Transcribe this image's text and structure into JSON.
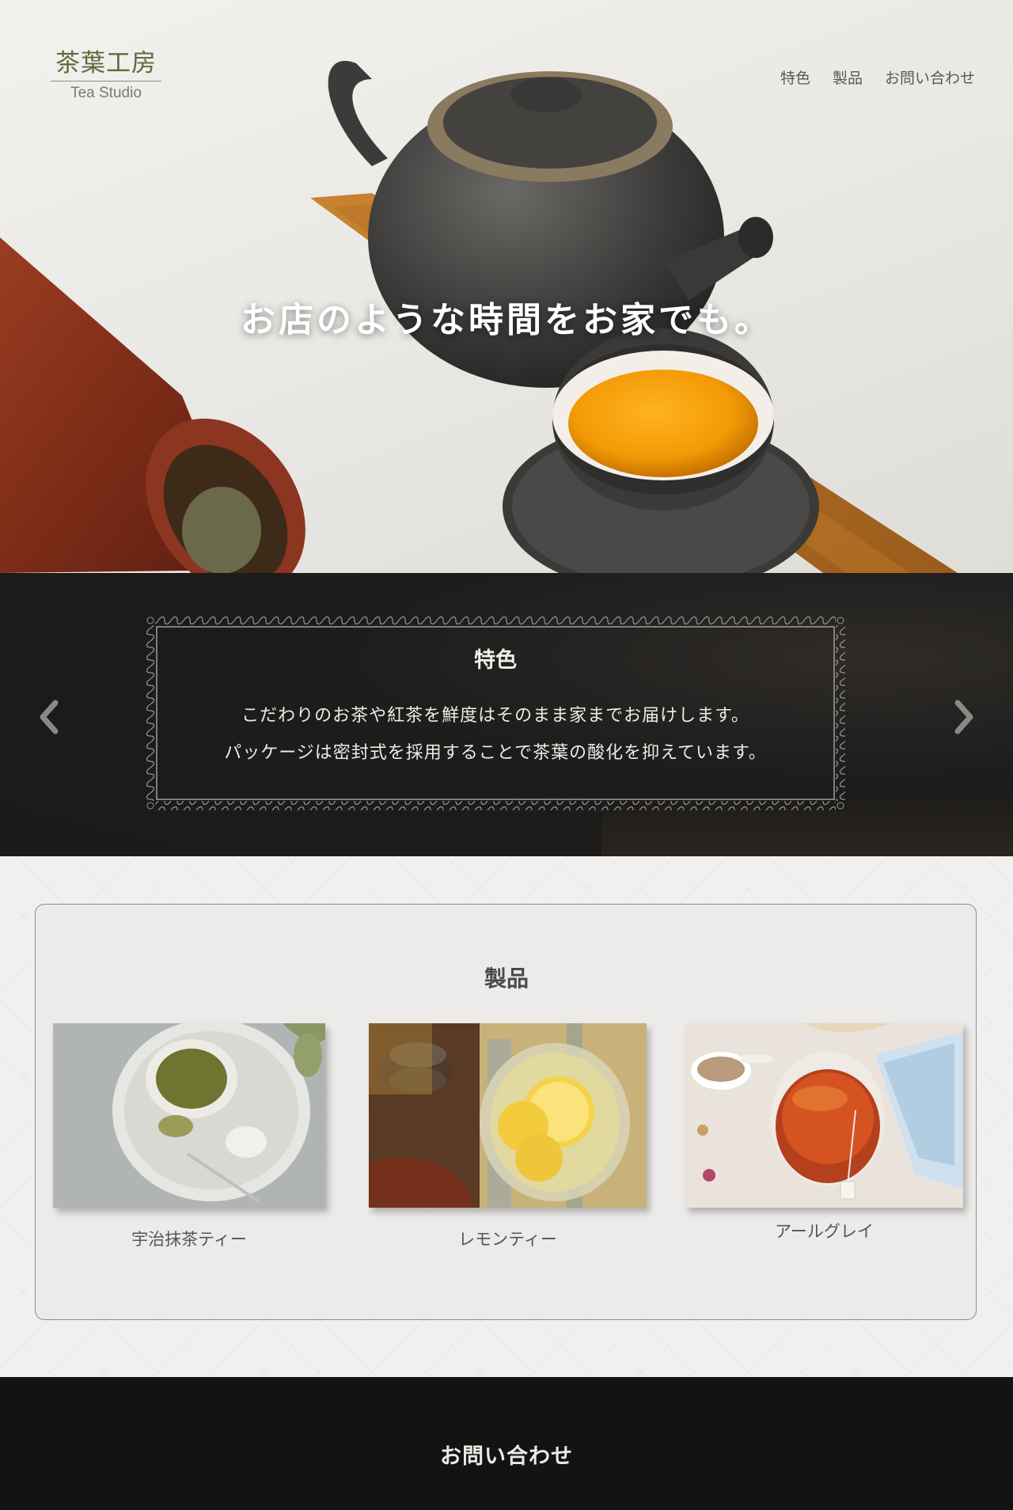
{
  "header": {
    "logo_jp": "茶葉工房",
    "logo_en": "Tea Studio",
    "nav": [
      {
        "label": "特色"
      },
      {
        "label": "製品"
      },
      {
        "label": "お問い合わせ"
      }
    ]
  },
  "hero": {
    "headline": "お店のような時間をお家でも。"
  },
  "feature": {
    "title": "特色",
    "line1": "こだわりのお茶や紅茶を鮮度はそのまま家までお届けします。",
    "line2": "パッケージは密封式を採用することで茶葉の酸化を抑えています。",
    "prev_icon": "chevron-left-icon",
    "next_icon": "chevron-right-icon"
  },
  "products": {
    "title": "製品",
    "items": [
      {
        "name": "宇治抹茶ティー",
        "image": "matcha-tea-photo"
      },
      {
        "name": "レモンティー",
        "image": "lemon-tea-photo"
      },
      {
        "name": "アールグレイ",
        "image": "earl-grey-photo"
      }
    ]
  },
  "footer": {
    "title": "お問い合わせ"
  },
  "colors": {
    "logo_green": "#5f6a3a",
    "dark_band": "#1b1a19",
    "footer_bg": "#131313",
    "page_bg": "#f1f0ee"
  }
}
